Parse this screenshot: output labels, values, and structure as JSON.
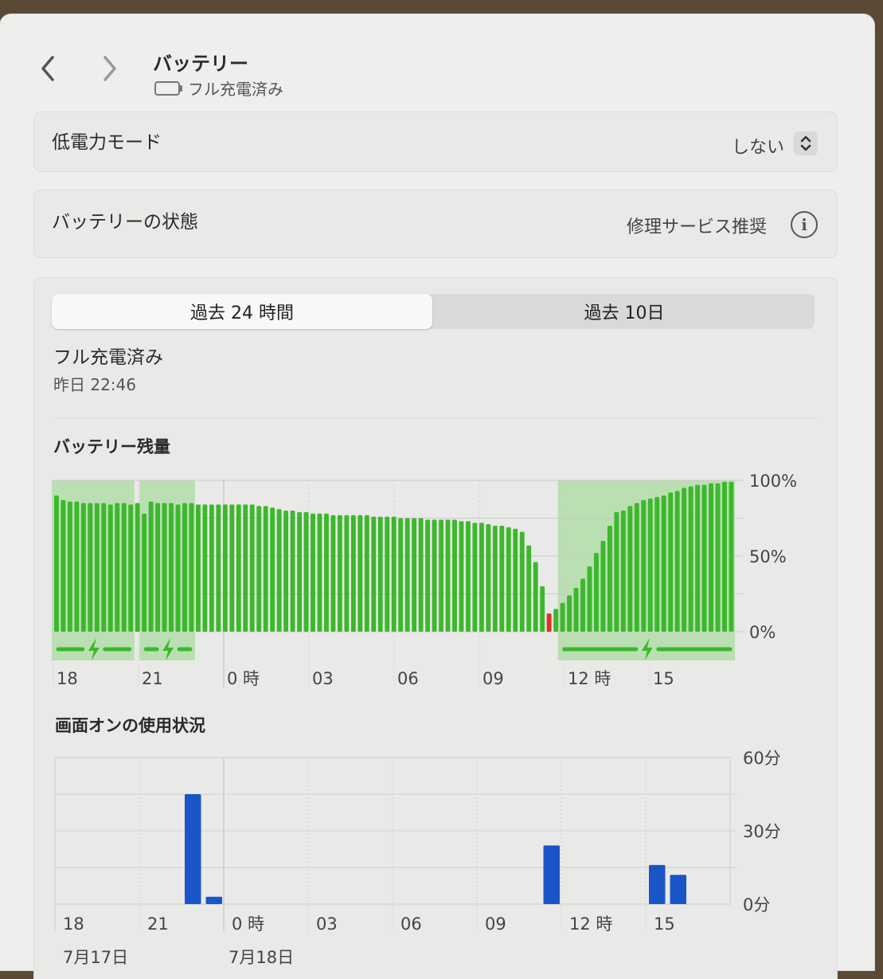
{
  "header": {
    "title": "バッテリー",
    "subtitle": "フル充電済み"
  },
  "low_power": {
    "label": "低電力モード",
    "value": "しない"
  },
  "health": {
    "label": "バッテリーの状態",
    "value": "修理サービス推奨"
  },
  "tabs": [
    {
      "label": "過去 24 時間",
      "active": true
    },
    {
      "label": "過去 10日",
      "active": false
    }
  ],
  "status": {
    "title": "フル充電済み",
    "time": "昨日 22:46"
  },
  "colors": {
    "battery_bar": "#3cb82c",
    "battery_low": "#e03020",
    "charging_band": "#a9dba0",
    "usage_bar": "#1a55c8"
  },
  "chart_data": [
    {
      "type": "bar",
      "title": "バッテリー残量",
      "x_ticks": [
        "18",
        "21",
        "0 時",
        "03",
        "06",
        "09",
        "12 時",
        "15"
      ],
      "y_ticks": [
        "100%",
        "50%",
        "0%"
      ],
      "ylim": [
        0,
        100
      ],
      "values": [
        90,
        87,
        86,
        86,
        85,
        85,
        85,
        85,
        84,
        85,
        85,
        84,
        85,
        78,
        86,
        85,
        85,
        85,
        84,
        85,
        85,
        84,
        84,
        84,
        84,
        84,
        84,
        84,
        84,
        84,
        83,
        83,
        82,
        81,
        80,
        80,
        79,
        79,
        78,
        78,
        78,
        77,
        77,
        77,
        77,
        77,
        77,
        76,
        76,
        76,
        76,
        75,
        75,
        75,
        75,
        74,
        74,
        74,
        74,
        74,
        73,
        73,
        72,
        72,
        71,
        70,
        70,
        69,
        68,
        66,
        57,
        46,
        30,
        12,
        15,
        19,
        24,
        29,
        35,
        43,
        52,
        60,
        70,
        79,
        80,
        83,
        85,
        87,
        88,
        89,
        90,
        92,
        93,
        95,
        96,
        97,
        97,
        98,
        98,
        99,
        99
      ],
      "low_index": 73,
      "charging_ranges": [
        [
          0,
          11
        ],
        [
          13,
          20
        ],
        [
          75,
          100
        ]
      ]
    },
    {
      "type": "bar",
      "title": "画面オンの使用状況",
      "x_ticks": [
        "18",
        "21",
        "0 時",
        "03",
        "06",
        "09",
        "12 時",
        "15"
      ],
      "date_labels": [
        "7月17日",
        "7月18日"
      ],
      "y_ticks": [
        "60分",
        "30分",
        "0分"
      ],
      "ylim": [
        0,
        60
      ],
      "values": [
        0,
        0,
        0,
        0,
        0,
        0,
        0,
        0,
        0,
        0,
        0,
        0,
        0,
        0,
        0,
        0,
        0,
        0,
        0,
        0,
        0,
        0,
        0,
        0,
        0,
        0,
        0,
        0,
        0,
        0,
        0,
        0,
        0,
        0,
        0,
        0,
        0,
        0,
        0,
        0,
        0,
        0,
        0,
        0,
        0,
        0,
        0,
        0,
        0,
        0,
        0,
        0,
        0,
        0,
        0,
        0,
        0,
        0,
        0,
        0,
        0,
        0,
        0,
        0,
        0,
        0,
        0,
        0,
        0,
        0,
        0,
        0,
        0,
        0,
        0,
        0,
        0,
        0,
        0,
        0,
        0,
        0,
        0,
        0,
        0,
        0,
        0,
        0,
        0,
        0,
        0,
        0,
        0,
        0,
        0,
        0
      ],
      "usage": [
        {
          "slot": 6,
          "minutes": 45
        },
        {
          "slot": 7,
          "minutes": 3
        },
        {
          "slot": 23,
          "minutes": 24
        },
        {
          "slot": 28,
          "minutes": 16
        },
        {
          "slot": 29,
          "minutes": 12
        }
      ]
    }
  ]
}
